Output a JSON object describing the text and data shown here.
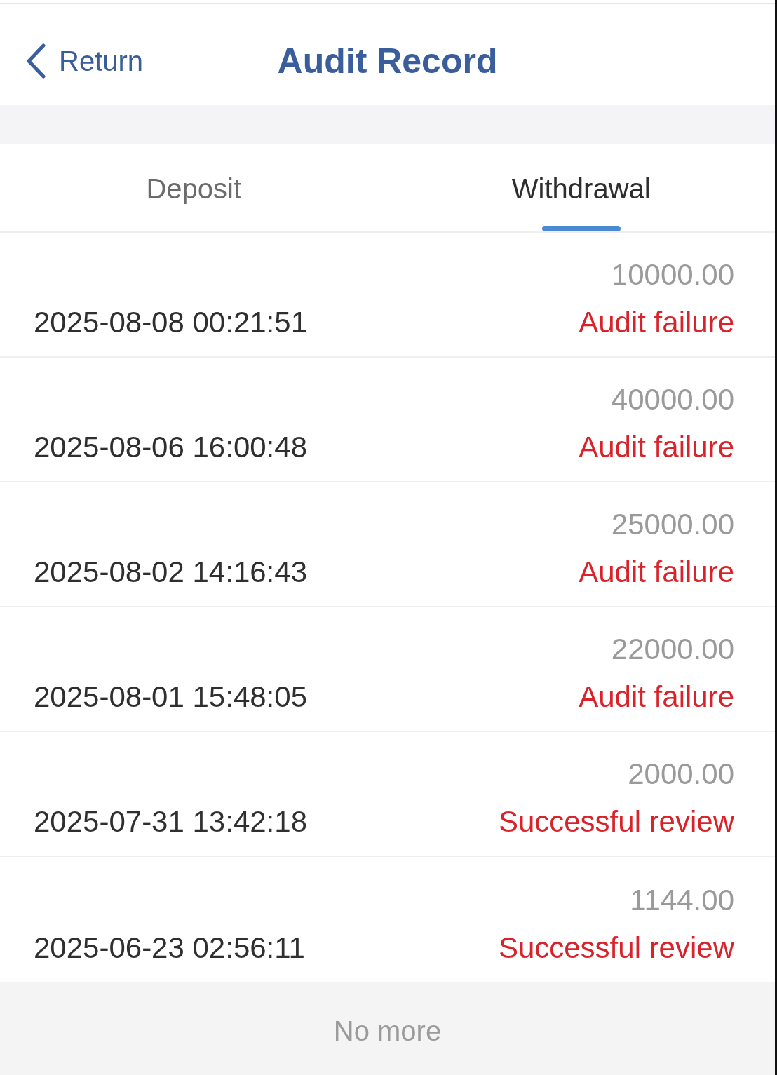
{
  "header": {
    "back_label": "Return",
    "title": "Audit Record"
  },
  "tabs": [
    {
      "label": "Deposit",
      "selected": false
    },
    {
      "label": "Withdrawal",
      "selected": true
    }
  ],
  "records": [
    {
      "time": "2025-08-08 00:21:51",
      "amount": "10000.00",
      "status": "Audit failure"
    },
    {
      "time": "2025-08-06 16:00:48",
      "amount": "40000.00",
      "status": "Audit failure"
    },
    {
      "time": "2025-08-02 14:16:43",
      "amount": "25000.00",
      "status": "Audit failure"
    },
    {
      "time": "2025-08-01 15:48:05",
      "amount": "22000.00",
      "status": "Audit failure"
    },
    {
      "time": "2025-07-31 13:42:18",
      "amount": "2000.00",
      "status": "Successful review"
    },
    {
      "time": "2025-06-23 02:56:11",
      "amount": "1144.00",
      "status": "Successful review"
    }
  ],
  "footer": {
    "text": "No more"
  }
}
